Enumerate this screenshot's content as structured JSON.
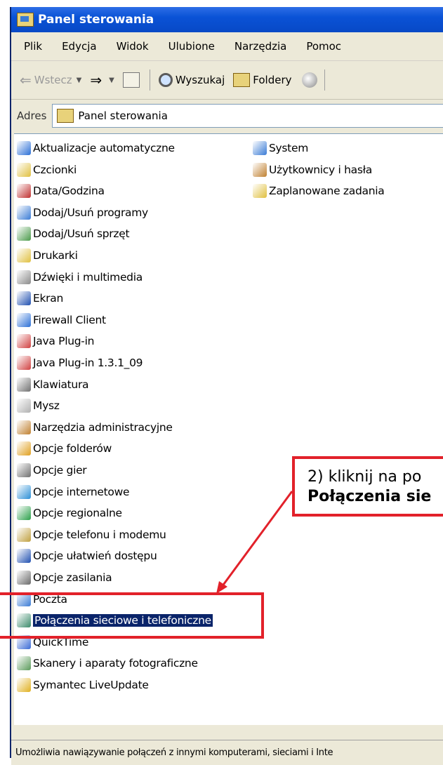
{
  "window": {
    "title": "Panel sterowania"
  },
  "menu": [
    "Plik",
    "Edycja",
    "Widok",
    "Ulubione",
    "Narzędzia",
    "Pomoc"
  ],
  "toolbar": {
    "back": "Wstecz",
    "search": "Wyszukaj",
    "folders": "Foldery"
  },
  "address": {
    "label": "Adres",
    "value": "Panel sterowania"
  },
  "items_col1": [
    {
      "label": "Aktualizacje automatyczne",
      "icon": "auto-update-icon",
      "color": "#2b6fd6"
    },
    {
      "label": "Czcionki",
      "icon": "fonts-icon",
      "color": "#e0c040"
    },
    {
      "label": "Data/Godzina",
      "icon": "clock-icon",
      "color": "#c03030"
    },
    {
      "label": "Dodaj/Usuń programy",
      "icon": "programs-icon",
      "color": "#3a7bd5"
    },
    {
      "label": "Dodaj/Usuń sprzęt",
      "icon": "hardware-icon",
      "color": "#4a9a4a"
    },
    {
      "label": "Drukarki",
      "icon": "printer-icon",
      "color": "#e0c040"
    },
    {
      "label": "Dźwięki i multimedia",
      "icon": "speaker-icon",
      "color": "#8a8a8a"
    },
    {
      "label": "Ekran",
      "icon": "display-icon",
      "color": "#2050b0"
    },
    {
      "label": "Firewall Client",
      "icon": "firewall-icon",
      "color": "#2b6fd6"
    },
    {
      "label": "Java Plug-in",
      "icon": "java-icon",
      "color": "#d04040"
    },
    {
      "label": "Java Plug-in 1.3.1_09",
      "icon": "java-icon",
      "color": "#d04040"
    },
    {
      "label": "Klawiatura",
      "icon": "keyboard-icon",
      "color": "#707070"
    },
    {
      "label": "Mysz",
      "icon": "mouse-icon",
      "color": "#b0b0b0"
    },
    {
      "label": "Narzędzia administracyjne",
      "icon": "admin-tools-icon",
      "color": "#c08030"
    },
    {
      "label": "Opcje folderów",
      "icon": "folder-options-icon",
      "color": "#e0a020"
    },
    {
      "label": "Opcje gier",
      "icon": "game-controller-icon",
      "color": "#707070"
    },
    {
      "label": "Opcje internetowe",
      "icon": "internet-globe-icon",
      "color": "#2b8fd6"
    },
    {
      "label": "Opcje regionalne",
      "icon": "regional-globe-icon",
      "color": "#2ba04a"
    },
    {
      "label": "Opcje telefonu i modemu",
      "icon": "phone-icon",
      "color": "#c0a040"
    },
    {
      "label": "Opcje ułatwień dostępu",
      "icon": "accessibility-icon",
      "color": "#2050b0"
    },
    {
      "label": "Opcje zasilania",
      "icon": "power-icon",
      "color": "#6a6a6a"
    },
    {
      "label": "Poczta",
      "icon": "mail-icon",
      "color": "#3a7bd5"
    },
    {
      "label": "Połączenia sieciowe i telefoniczne",
      "icon": "network-connections-icon",
      "color": "#3a8a6a",
      "selected": true
    },
    {
      "label": "QuickTime",
      "icon": "quicktime-icon",
      "color": "#3a6ad5"
    },
    {
      "label": "Skanery i aparaty fotograficzne",
      "icon": "scanner-icon",
      "color": "#5a9a5a"
    },
    {
      "label": "Symantec LiveUpdate",
      "icon": "liveupdate-icon",
      "color": "#e0b020"
    }
  ],
  "items_col2": [
    {
      "label": "System",
      "icon": "computer-icon",
      "color": "#3a7bd5"
    },
    {
      "label": "Użytkownicy i hasła",
      "icon": "users-icon",
      "color": "#c08030"
    },
    {
      "label": "Zaplanowane zadania",
      "icon": "scheduled-tasks-icon",
      "color": "#e0c040"
    }
  ],
  "statusbar": {
    "text": "Umożliwia nawiązywanie połączeń z innymi komputerami, sieciami i Inte"
  },
  "annotation": {
    "line1": "2) kliknij na po",
    "line2": "Połączenia sie",
    "color": "#e2212a"
  }
}
